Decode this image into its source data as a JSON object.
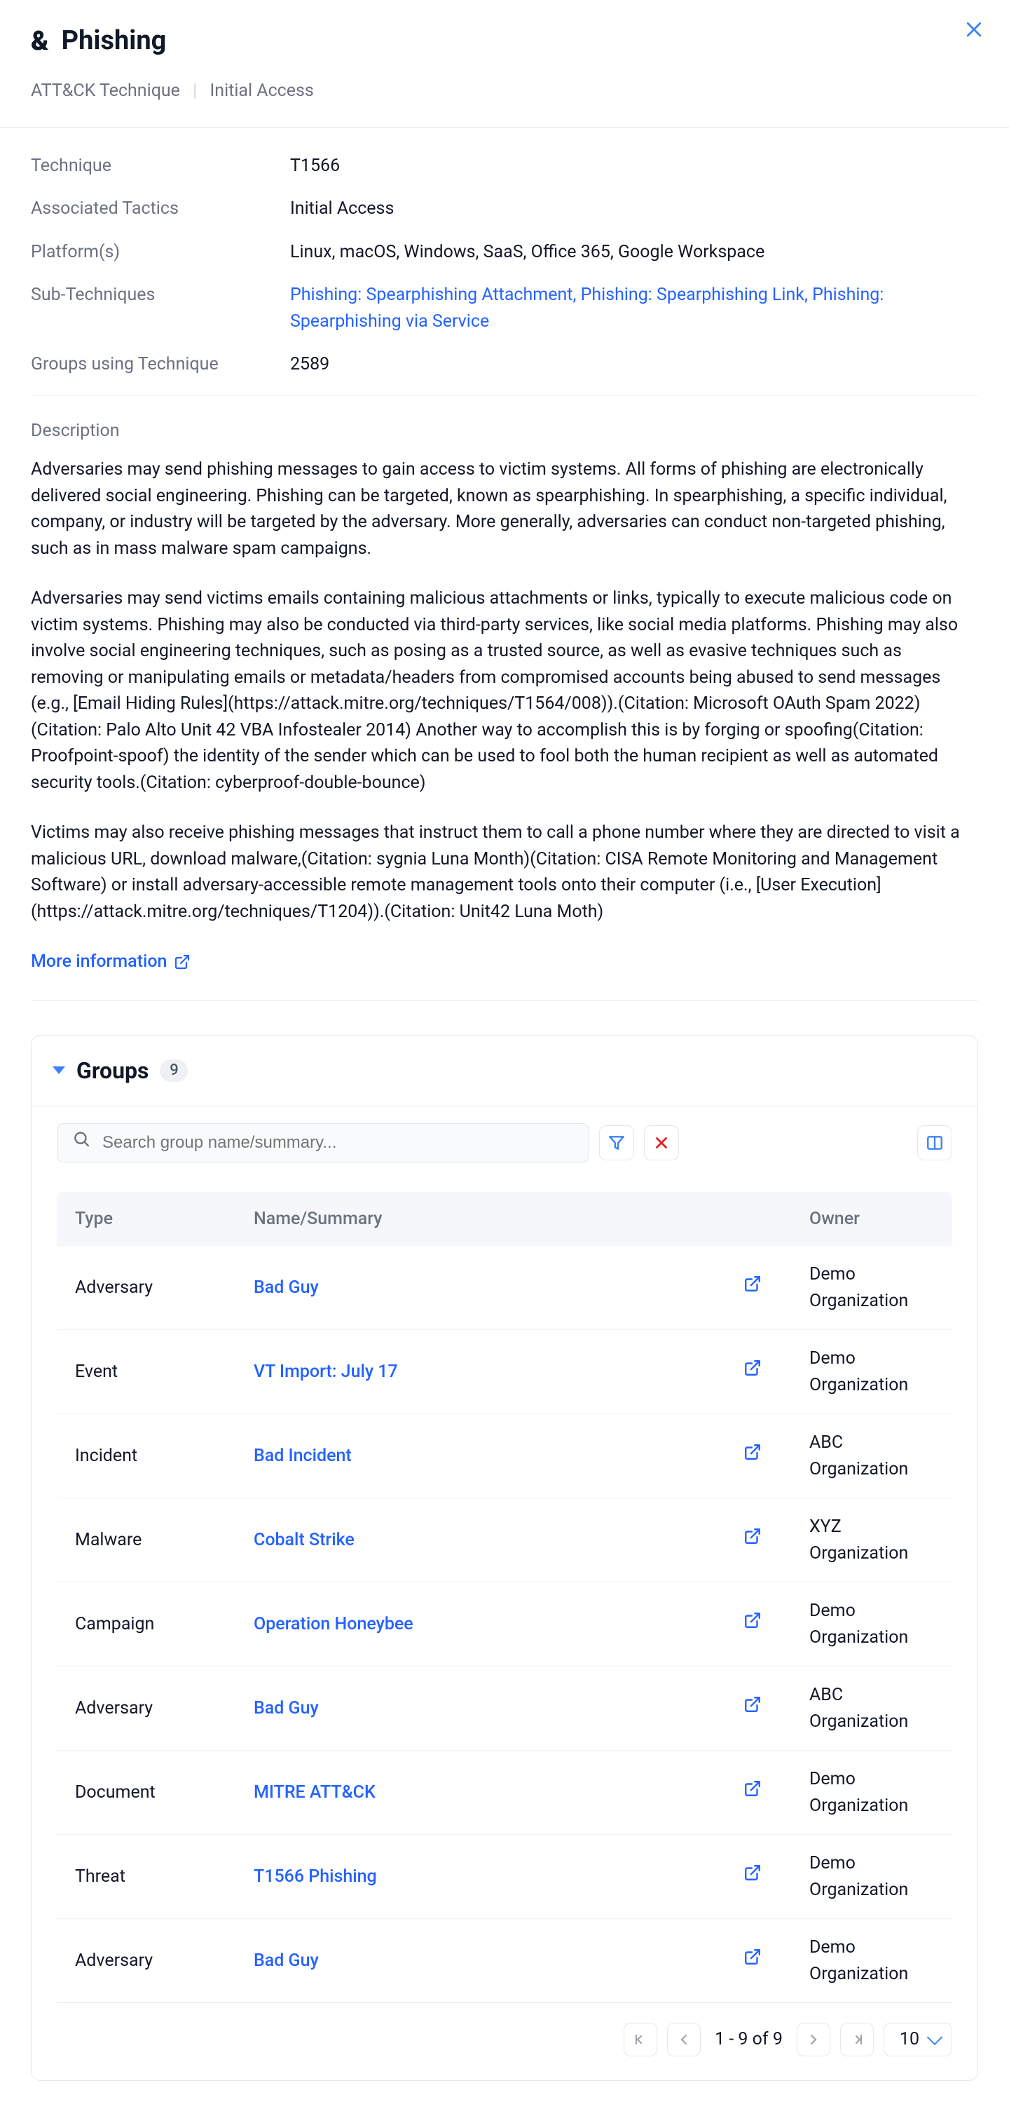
{
  "header": {
    "title": "Phishing",
    "breadcrumb_l1": "ATT&CK Technique",
    "breadcrumb_l2": "Initial Access"
  },
  "info": {
    "technique_label": "Technique",
    "technique": "T1566",
    "tactics_label": "Associated Tactics",
    "tactics": "Initial Access",
    "platforms_label": "Platform(s)",
    "platforms": "Linux, macOS, Windows, SaaS, Office 365, Google Workspace",
    "sub_label": "Sub-Techniques",
    "sub": "Phishing: Spearphishing Attachment, Phishing: Spearphishing Link, Phishing: Spearphishing via Service",
    "groups_using_label": "Groups using Technique",
    "groups_using": "2589"
  },
  "description": {
    "label": "Description",
    "para1": "Adversaries may send phishing messages to gain access to victim systems. All forms of phishing are electronically delivered social engineering. Phishing can be targeted, known as spearphishing. In spearphishing, a specific individual, company, or industry will be targeted by the adversary. More generally, adversaries can conduct non-targeted phishing, such as in mass malware spam campaigns.",
    "para2": "Adversaries may send victims emails containing malicious attachments or links, typically to execute malicious code on victim systems. Phishing may also be conducted via third-party services, like social media platforms. Phishing may also involve social engineering techniques, such as posing as a trusted source, as well as evasive techniques such as removing or manipulating emails or metadata/headers from compromised accounts being abused to send messages (e.g., [Email Hiding Rules](https://attack.mitre.org/techniques/T1564/008)).(Citation: Microsoft OAuth Spam 2022)(Citation: Palo Alto Unit 42 VBA Infostealer 2014) Another way to accomplish this is by forging or spoofing(Citation: Proofpoint-spoof) the identity of the sender which can be used to fool both the human recipient as well as automated security tools.(Citation: cyberproof-double-bounce)",
    "para3": "Victims may also receive phishing messages that instruct them to call a phone number where they are directed to visit a malicious URL, download malware,(Citation: sygnia Luna Month)(Citation: CISA Remote Monitoring and Management Software) or install adversary-accessible remote management tools onto their computer (i.e., [User Execution](https://attack.mitre.org/techniques/T1204)).(Citation: Unit42 Luna Moth)",
    "more_info": "More information"
  },
  "groups": {
    "title": "Groups",
    "count": "9",
    "search_placeholder": "Search group name/summary...",
    "cols": {
      "type": "Type",
      "name": "Name/Summary",
      "owner": "Owner"
    },
    "rows": [
      {
        "type": "Adversary",
        "name": "Bad Guy",
        "owner": "Demo Organization"
      },
      {
        "type": "Event",
        "name": "VT Import: July 17",
        "owner": "Demo Organization"
      },
      {
        "type": "Incident",
        "name": "Bad Incident",
        "owner": "ABC Organization"
      },
      {
        "type": "Malware",
        "name": "Cobalt Strike",
        "owner": "XYZ Organization"
      },
      {
        "type": "Campaign",
        "name": "Operation Honeybee",
        "owner": "Demo Organization"
      },
      {
        "type": "Adversary",
        "name": "Bad Guy",
        "owner": "ABC Organization"
      },
      {
        "type": "Document",
        "name": "MITRE ATT&CK",
        "owner": "Demo Organization"
      },
      {
        "type": "Threat",
        "name": "T1566 Phishing",
        "owner": "Demo Organization"
      },
      {
        "type": "Adversary",
        "name": "Bad Guy",
        "owner": "Demo Organization"
      }
    ],
    "page_info": "1 - 9 of 9",
    "page_size": "10"
  }
}
